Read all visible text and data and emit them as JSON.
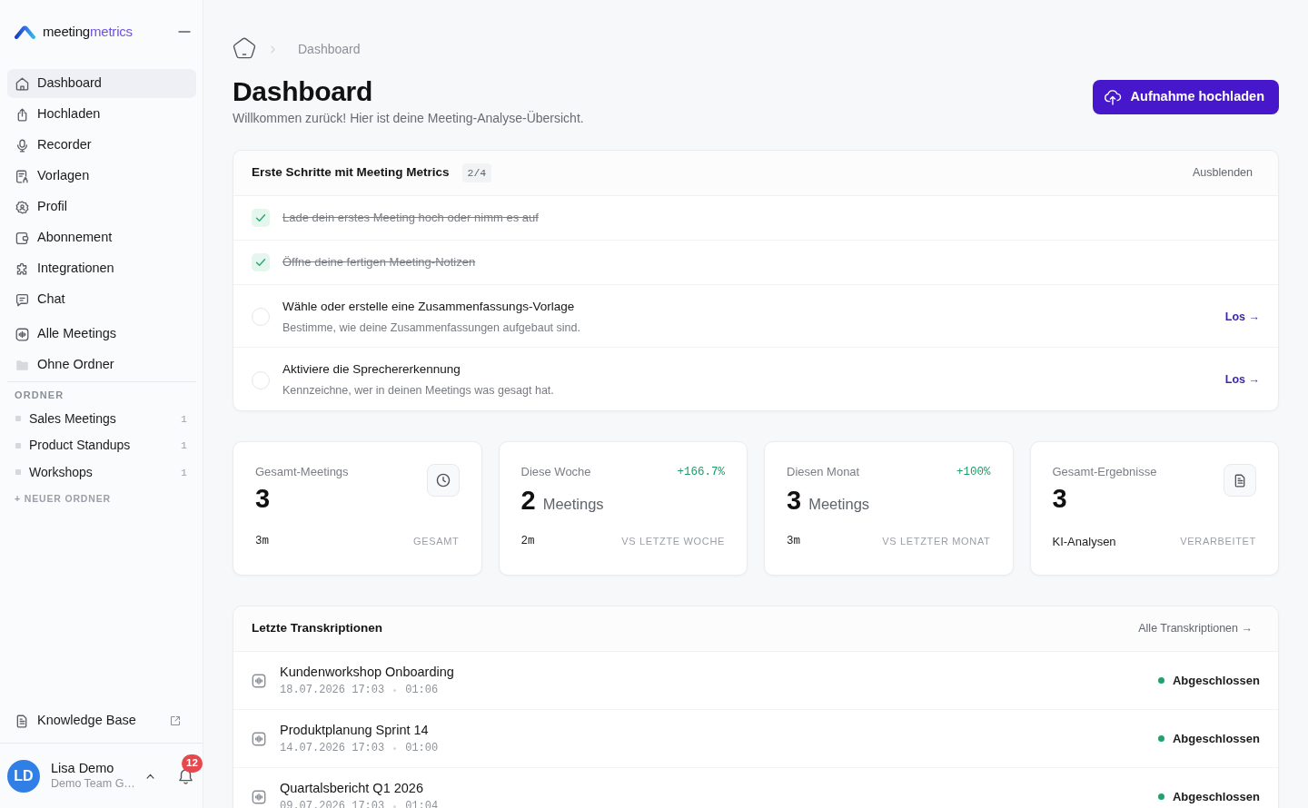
{
  "sidebar": {
    "logo": {
      "part_1": "meeting",
      "part_2": "metrics"
    },
    "nav_items": [
      {
        "label": "Dashboard",
        "selected": true
      },
      {
        "label": "Hochladen",
        "selected": false
      },
      {
        "label": "Recorder",
        "selected": false
      },
      {
        "label": "Vorlagen",
        "selected": false
      },
      {
        "label": "Profil",
        "selected": false
      },
      {
        "label": "Abonnement",
        "selected": false
      },
      {
        "label": "Integrationen",
        "selected": false
      },
      {
        "label": "Chat",
        "selected": false
      }
    ],
    "library_items": [
      {
        "label": "Alle Meetings",
        "selected": false
      },
      {
        "label": "Ohne Ordner",
        "selected": false
      }
    ],
    "folders_heading": "ORDNER",
    "folders": [
      {
        "name": "Sales Meetings",
        "count": "1"
      },
      {
        "name": "Product Standups",
        "count": "1"
      },
      {
        "name": "Workshops",
        "count": "1"
      }
    ],
    "new_folder": "+ NEUER ORDNER",
    "knowledge_base": "Knowledge Base",
    "user": {
      "initials": "LD",
      "name": "Lisa Demo",
      "team": "Demo Team G…",
      "notifications": "12"
    }
  },
  "breadcrumb": [
    "Dashboard"
  ],
  "header": {
    "title": "Dashboard",
    "subtitle": "Willkommen zurück! Hier ist deine Meeting-Analyse-Übersicht.",
    "upload_button": "Aufnahme hochladen"
  },
  "onboarding": {
    "title": "Erste Schritte mit Meeting Metrics",
    "progress": "2/4",
    "hide": "Ausblenden",
    "steps": [
      {
        "title": "Lade dein erstes Meeting hoch oder nimm es auf",
        "checked": true
      },
      {
        "title": "Öffne deine fertigen Meeting-Notizen",
        "checked": true
      },
      {
        "title": "Wähle oder erstelle eine Zusammenfassungs-Vorlage",
        "description": "Bestimme, wie deine Zusammenfassungen aufgebaut sind.",
        "action": "Los →",
        "checked": false
      },
      {
        "title": "Aktiviere die Sprechererkennung",
        "description": "Kennzeichne, wer in deinen Meetings was gesagt hat.",
        "action": "Los →",
        "checked": false
      }
    ]
  },
  "stats": [
    {
      "kind": "total",
      "label": "Gesamt-Meetings",
      "value": "3",
      "footer": "3m",
      "caption": "GESAMT"
    },
    {
      "kind": "trend",
      "label": "Diese Woche",
      "trend": "+166.7%",
      "value": "2",
      "unit": "Meetings",
      "footer": "2m",
      "caption": "VS LETZTE WOCHE"
    },
    {
      "kind": "trend",
      "label": "Diesen Monat",
      "trend": "+100%",
      "value": "3",
      "unit": "Meetings",
      "footer": "3m",
      "caption": "VS LETZTER MONAT"
    },
    {
      "kind": "results",
      "label": "Gesamt-Ergebnisse",
      "value": "3",
      "footer": "KI-Analysen",
      "caption": "VERARBEITET"
    }
  ],
  "transcriptions": {
    "title": "Letzte Transkriptionen",
    "all_link": "Alle Transkriptionen →",
    "rows": [
      {
        "title": "Kundenworkshop Onboarding",
        "date": "18.07.2026 17:03",
        "duration": "01:06",
        "status": "Abgeschlossen",
        "color": "#1fa36e"
      },
      {
        "title": "Produktplanung Sprint 14",
        "date": "14.07.2026 17:03",
        "duration": "01:00",
        "status": "Abgeschlossen",
        "color": "#1fa36e"
      },
      {
        "title": "Quartalsbericht Q1 2026",
        "date": "09.07.2026 17:03",
        "duration": "01:04",
        "status": "Abgeschlossen",
        "color": "#1fa36e"
      }
    ]
  }
}
